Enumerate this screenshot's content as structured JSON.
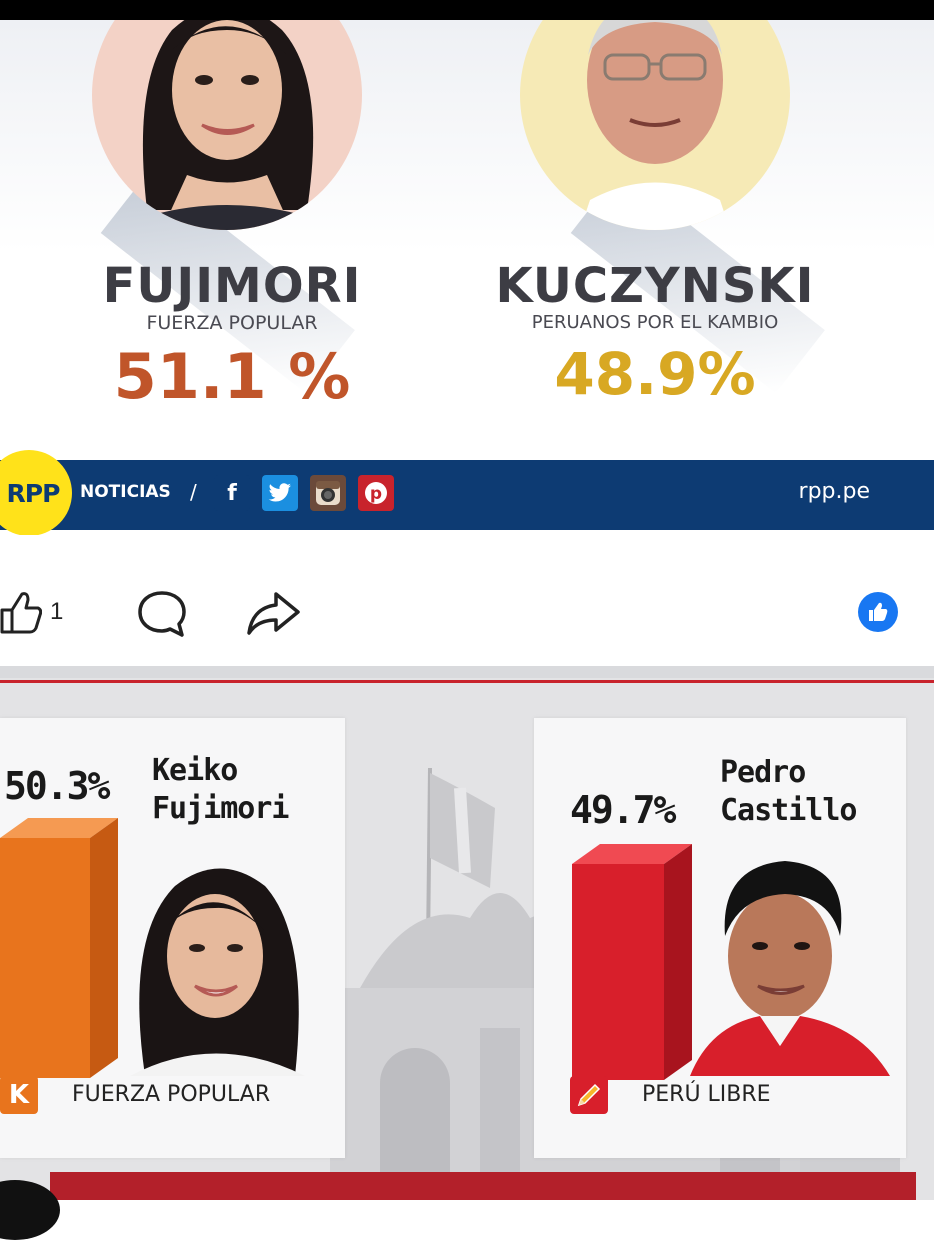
{
  "top": {
    "candidates": [
      {
        "name": "FUJIMORI",
        "party": "FUERZA POPULAR",
        "percent": "51.1 %",
        "color": "#c0552a"
      },
      {
        "name": "KUCZYNSKI",
        "party": "PERUANOS POR EL KAMBIO",
        "percent": "48.9%",
        "color": "#d8a823"
      }
    ],
    "brand_bar": {
      "logo": "RPP",
      "label": "NOTICIAS",
      "separator": "/",
      "social_icons": [
        "facebook-icon",
        "twitter-icon",
        "instagram-icon",
        "pinterest-icon"
      ],
      "url": "rpp.pe",
      "color": "#0d3b73"
    }
  },
  "post_actions": {
    "like_count": "1",
    "icons": [
      "like-icon",
      "comment-icon",
      "share-icon",
      "facebook-like-reaction-icon"
    ]
  },
  "bottom": {
    "candidates": [
      {
        "percent": "50.3%",
        "name_line1": "Keiko",
        "name_line2": "Fujimori",
        "party": "FUERZA POPULAR",
        "party_icon_letter": "K",
        "bar_color": "#e8741d"
      },
      {
        "percent": "49.7%",
        "name_line1": "Pedro",
        "name_line2": "Castillo",
        "party": "PERÚ LIBRE",
        "party_icon": "pencil-icon",
        "bar_color": "#d81f2b"
      }
    ]
  }
}
